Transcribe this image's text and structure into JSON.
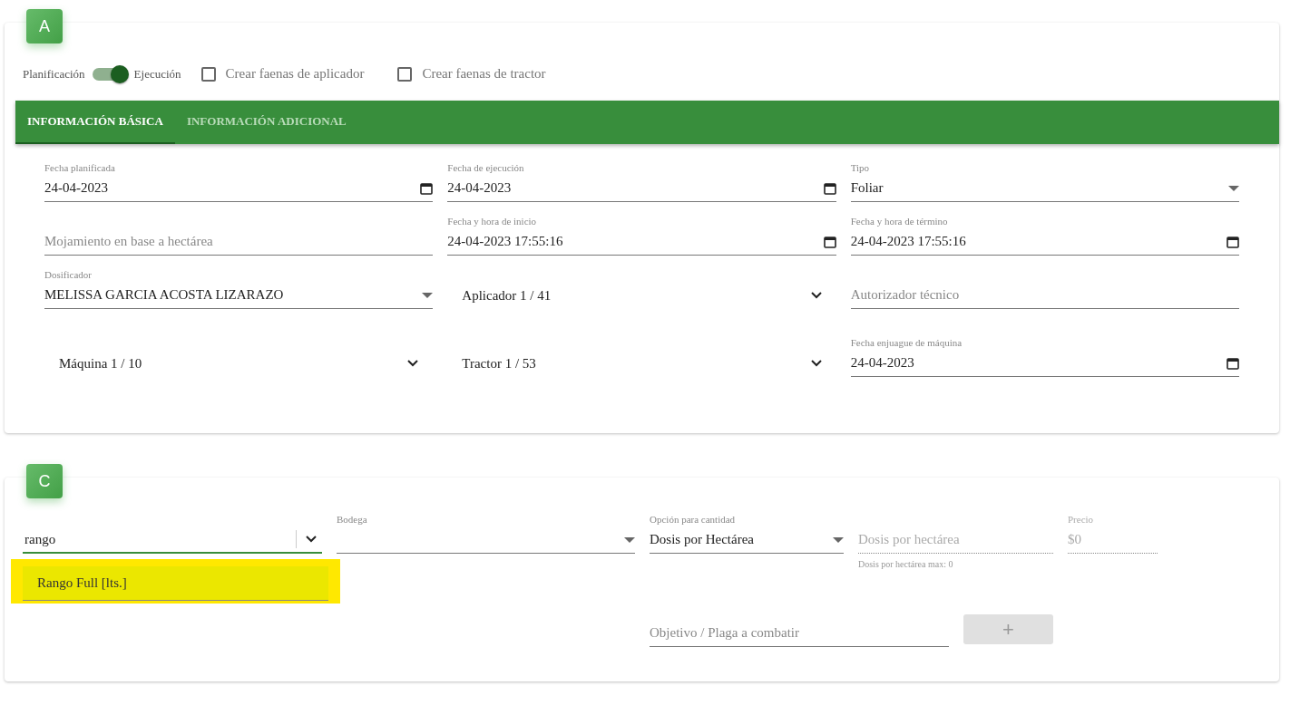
{
  "card_a": {
    "badge": "A",
    "toggle": {
      "left_label": "Planificación",
      "right_label": "Ejecución",
      "on": true
    },
    "checkboxes": [
      {
        "label": "Crear faenas de aplicador",
        "checked": false
      },
      {
        "label": "Crear faenas de tractor",
        "checked": false
      }
    ],
    "tabs": [
      {
        "label": "INFORMACIÓN BÁSICA",
        "selected": true
      },
      {
        "label": "INFORMACIÓN ADICIONAL",
        "selected": false
      }
    ],
    "rows": [
      [
        {
          "kind": "date",
          "label": "Fecha planificada",
          "value": "24-04-2023"
        },
        {
          "kind": "date",
          "label": "Fecha de ejecución",
          "value": "24-04-2023"
        },
        {
          "kind": "select",
          "label": "Tipo",
          "value": "Foliar"
        }
      ],
      [
        {
          "kind": "text",
          "placeholder": "Mojamiento en base a hectárea"
        },
        {
          "kind": "date",
          "label": "Fecha y hora de inicio",
          "value": "24-04-2023  17:55:16"
        },
        {
          "kind": "date",
          "label": "Fecha y hora de término",
          "value": "24-04-2023  17:55:16"
        }
      ],
      [
        {
          "kind": "select",
          "label": "Dosificador",
          "value": "MELISSA GARCIA ACOSTA LIZARAZO"
        },
        {
          "kind": "combo",
          "value": "Aplicador 1 / 41"
        },
        {
          "kind": "text",
          "placeholder": "Autorizador técnico"
        }
      ],
      [
        {
          "kind": "combo",
          "value": "Máquina 1 / 10"
        },
        {
          "kind": "combo",
          "value": "Tractor 1 / 53"
        },
        {
          "kind": "date",
          "label": "Fecha enjuague de máquina",
          "value": "24-04-2023"
        }
      ]
    ]
  },
  "card_c": {
    "badge": "C",
    "search": {
      "value": "rango",
      "options": [
        "Rango Full [lts.]"
      ]
    },
    "bodega": {
      "label": "Bodega"
    },
    "quantity_option": {
      "label": "Opción para cantidad",
      "value": "Dosis por Hectárea"
    },
    "dose": {
      "placeholder": "Dosis por hectárea",
      "hint": "Dosis por hectárea max: 0",
      "disabled": true
    },
    "price": {
      "label": "Precio",
      "placeholder": "$0",
      "disabled": true
    },
    "objective": {
      "placeholder": "Objetivo / Plaga a combatir"
    },
    "add_button": {
      "label": "+",
      "disabled": true
    }
  }
}
